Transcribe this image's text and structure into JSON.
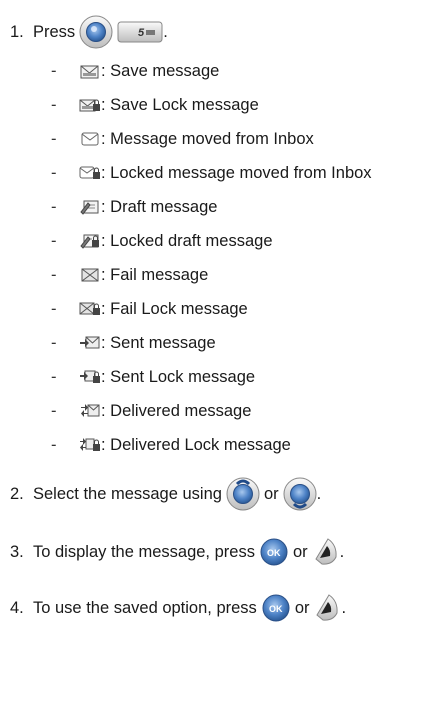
{
  "step1": {
    "number": "1.",
    "text": "Press",
    "end": "."
  },
  "icons": [
    {
      "icon": "save-message-icon",
      "label": ": Save message"
    },
    {
      "icon": "save-lock-message-icon",
      "label": ": Save Lock message"
    },
    {
      "icon": "message-moved-from-inbox-icon",
      "label": ": Message moved from Inbox"
    },
    {
      "icon": "locked-message-moved-from-inbox-icon",
      "label": ": Locked message moved from Inbox"
    },
    {
      "icon": "draft-message-icon",
      "label": ": Draft message"
    },
    {
      "icon": "locked-draft-message-icon",
      "label": ": Locked draft message"
    },
    {
      "icon": "fail-message-icon",
      "label": ": Fail message"
    },
    {
      "icon": "fail-lock-message-icon",
      "label": ": Fail Lock message"
    },
    {
      "icon": "sent-message-icon",
      "label": ": Sent message"
    },
    {
      "icon": "sent-lock-message-icon",
      "label": ": Sent Lock message"
    },
    {
      "icon": "delivered-message-icon",
      "label": ": Delivered message"
    },
    {
      "icon": "delivered-lock-message-icon",
      "label": ": Delivered Lock message"
    }
  ],
  "step2": {
    "number": "2.",
    "text": "Select the message using",
    "or": "or",
    "end": "."
  },
  "step3": {
    "number": "3.",
    "text": "To display the message, press",
    "or": "or",
    "end": "."
  },
  "step4": {
    "number": "4.",
    "text": "To use the saved option, press",
    "or": "or",
    "end": "."
  },
  "key5": {
    "label": "5"
  },
  "ok_key": {
    "label": "OK"
  }
}
